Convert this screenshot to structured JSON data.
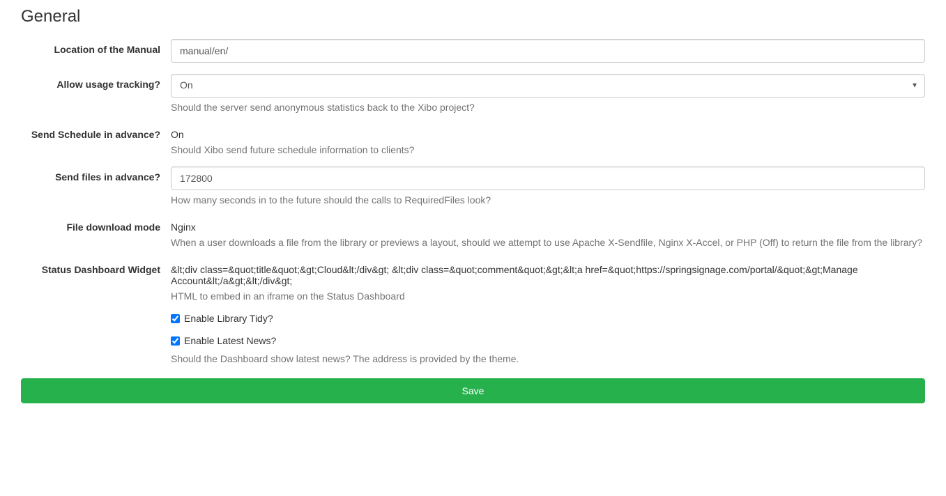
{
  "section_title": "General",
  "fields": {
    "manual_location": {
      "label": "Location of the Manual",
      "value": "manual/en/"
    },
    "usage_tracking": {
      "label": "Allow usage tracking?",
      "value": "On",
      "help": "Should the server send anonymous statistics back to the Xibo project?"
    },
    "send_schedule": {
      "label": "Send Schedule in advance?",
      "value": "On",
      "help": "Should Xibo send future schedule information to clients?"
    },
    "send_files": {
      "label": "Send files in advance?",
      "value": "172800",
      "help": "How many seconds in to the future should the calls to RequiredFiles look?"
    },
    "download_mode": {
      "label": "File download mode",
      "value": "Nginx",
      "help": "When a user downloads a file from the library or previews a layout, should we attempt to use Apache X-Sendfile, Nginx X-Accel, or PHP (Off) to return the file from the library?"
    },
    "status_widget": {
      "label": "Status Dashboard Widget",
      "value": "&lt;div class=&quot;title&quot;&gt;Cloud&lt;/div&gt; &lt;div class=&quot;comment&quot;&gt;&lt;a href=&quot;https://springsignage.com/portal/&quot;&gt;Manage Account&lt;/a&gt;&lt;/div&gt;",
      "help": "HTML to embed in an iframe on the Status Dashboard"
    },
    "library_tidy": {
      "label": "Enable Library Tidy?"
    },
    "latest_news": {
      "label": "Enable Latest News?",
      "help": "Should the Dashboard show latest news? The address is provided by the theme."
    }
  },
  "save_button": "Save"
}
